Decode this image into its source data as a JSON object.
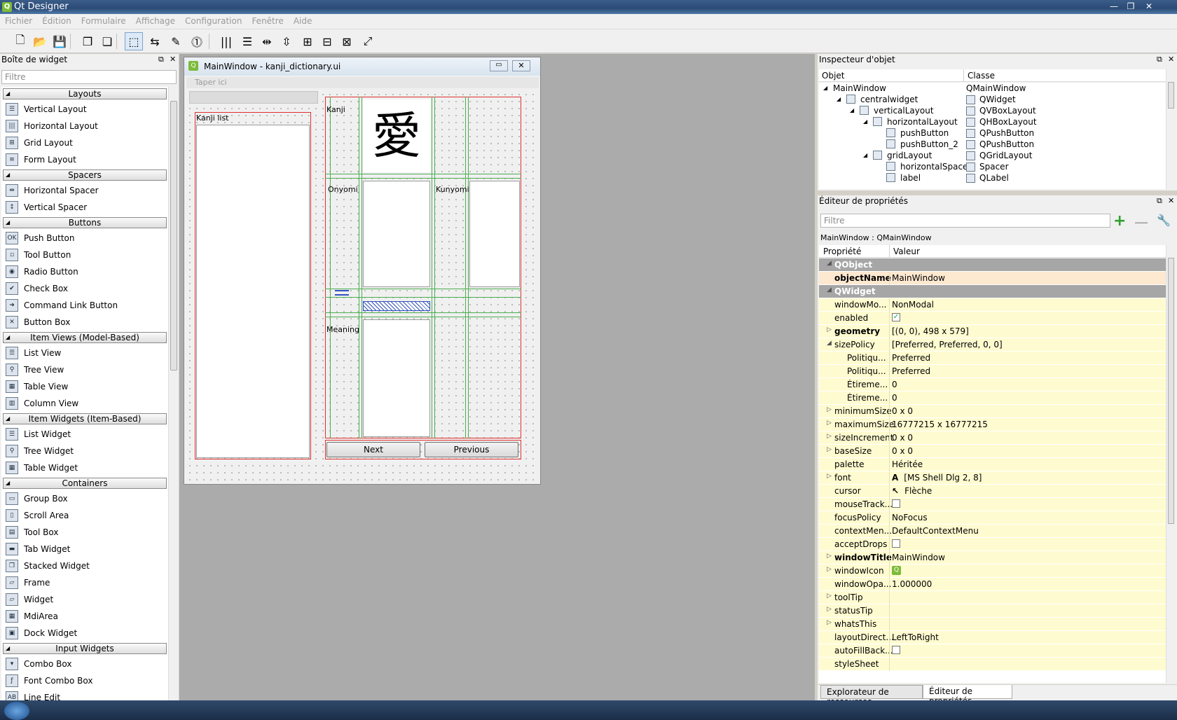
{
  "app": {
    "title": "Qt Designer",
    "icon": "qt-designer-icon"
  },
  "menu": [
    "Fichier",
    "Édition",
    "Formulaire",
    "Affichage",
    "Configuration",
    "Fenêtre",
    "Aide"
  ],
  "toolbar": {
    "icons": [
      "new-file-icon",
      "open-file-icon",
      "save-icon",
      "copy-icon",
      "paste-icon",
      "edit-widgets-icon",
      "edit-signals-icon",
      "edit-buddies-icon",
      "edit-tab-order-icon",
      "horizontal-layout-icon",
      "vertical-layout-icon",
      "horizontal-splitter-icon",
      "vertical-splitter-icon",
      "grid-layout-icon",
      "form-layout-icon",
      "break-layout-icon",
      "adjust-size-icon"
    ]
  },
  "widget_box": {
    "title": "Boîte de widget",
    "filter_placeholder": "Filtre",
    "categories": [
      {
        "name": "Layouts",
        "items": [
          {
            "label": "Vertical Layout",
            "icon": "vertical-layout-icon",
            "glyph": "☰"
          },
          {
            "label": "Horizontal Layout",
            "icon": "horizontal-layout-icon",
            "glyph": "|||"
          },
          {
            "label": "Grid Layout",
            "icon": "grid-layout-icon",
            "glyph": "⊞"
          },
          {
            "label": "Form Layout",
            "icon": "form-layout-icon",
            "glyph": "≡"
          }
        ]
      },
      {
        "name": "Spacers",
        "items": [
          {
            "label": "Horizontal Spacer",
            "icon": "horizontal-spacer-icon",
            "glyph": "⇹"
          },
          {
            "label": "Vertical Spacer",
            "icon": "vertical-spacer-icon",
            "glyph": "↕"
          }
        ]
      },
      {
        "name": "Buttons",
        "items": [
          {
            "label": "Push Button",
            "icon": "push-button-icon",
            "glyph": "OK"
          },
          {
            "label": "Tool Button",
            "icon": "tool-button-icon",
            "glyph": "▫"
          },
          {
            "label": "Radio Button",
            "icon": "radio-button-icon",
            "glyph": "◉"
          },
          {
            "label": "Check Box",
            "icon": "check-box-icon",
            "glyph": "✔"
          },
          {
            "label": "Command Link Button",
            "icon": "command-link-icon",
            "glyph": "➜"
          },
          {
            "label": "Button Box",
            "icon": "button-box-icon",
            "glyph": "✕"
          }
        ]
      },
      {
        "name": "Item Views (Model-Based)",
        "items": [
          {
            "label": "List View",
            "icon": "list-view-icon",
            "glyph": "☰"
          },
          {
            "label": "Tree View",
            "icon": "tree-view-icon",
            "glyph": "⚲"
          },
          {
            "label": "Table View",
            "icon": "table-view-icon",
            "glyph": "▦"
          },
          {
            "label": "Column View",
            "icon": "column-view-icon",
            "glyph": "▥"
          }
        ]
      },
      {
        "name": "Item Widgets (Item-Based)",
        "items": [
          {
            "label": "List Widget",
            "icon": "list-widget-icon",
            "glyph": "☰"
          },
          {
            "label": "Tree Widget",
            "icon": "tree-widget-icon",
            "glyph": "⚲"
          },
          {
            "label": "Table Widget",
            "icon": "table-widget-icon",
            "glyph": "▦"
          }
        ]
      },
      {
        "name": "Containers",
        "items": [
          {
            "label": "Group Box",
            "icon": "group-box-icon",
            "glyph": "▭"
          },
          {
            "label": "Scroll Area",
            "icon": "scroll-area-icon",
            "glyph": "▯"
          },
          {
            "label": "Tool Box",
            "icon": "tool-box-icon",
            "glyph": "▤"
          },
          {
            "label": "Tab Widget",
            "icon": "tab-widget-icon",
            "glyph": "▬"
          },
          {
            "label": "Stacked Widget",
            "icon": "stacked-widget-icon",
            "glyph": "❐"
          },
          {
            "label": "Frame",
            "icon": "frame-icon",
            "glyph": "▱"
          },
          {
            "label": "Widget",
            "icon": "widget-icon",
            "glyph": "▱"
          },
          {
            "label": "MdiArea",
            "icon": "mdi-area-icon",
            "glyph": "▦"
          },
          {
            "label": "Dock Widget",
            "icon": "dock-widget-icon",
            "glyph": "▣"
          }
        ]
      },
      {
        "name": "Input Widgets",
        "items": [
          {
            "label": "Combo Box",
            "icon": "combo-box-icon",
            "glyph": "▾"
          },
          {
            "label": "Font Combo Box",
            "icon": "font-combo-box-icon",
            "glyph": "ƒ"
          },
          {
            "label": "Line Edit",
            "icon": "line-edit-icon",
            "glyph": "AB"
          }
        ]
      }
    ]
  },
  "design_window": {
    "title": "MainWindow - kanji_dictionary.ui",
    "menu_placeholder": "Taper ici",
    "kanji_list_label": "Kanji list",
    "kanji_label": "Kanji",
    "kanji_char": "愛",
    "onyomi_label": "Onyomi",
    "kunyomi_label": "Kunyomi",
    "meaning_label": "Meaning",
    "next_button": "Next",
    "previous_button": "Previous"
  },
  "object_inspector": {
    "title": "Inspecteur d'objet",
    "col_object": "Objet",
    "col_class": "Classe",
    "rows": [
      {
        "name": "MainWindow",
        "cls": "QMainWindow",
        "icon": "",
        "indent": 0,
        "expand": "◢"
      },
      {
        "name": "centralwidget",
        "cls": "QWidget",
        "icon": "widget-icon",
        "indent": 1,
        "expand": "◢"
      },
      {
        "name": "verticalLayout",
        "cls": "QVBoxLayout",
        "icon": "vertical-layout-icon",
        "indent": 2,
        "expand": "◢"
      },
      {
        "name": "horizontalLayout",
        "cls": "QHBoxLayout",
        "icon": "horizontal-layout-icon",
        "indent": 3,
        "expand": "◢"
      },
      {
        "name": "pushButton",
        "cls": "QPushButton",
        "icon": "push-button-icon",
        "indent": 4,
        "expand": ""
      },
      {
        "name": "pushButton_2",
        "cls": "QPushButton",
        "icon": "push-button-icon",
        "indent": 4,
        "expand": ""
      },
      {
        "name": "gridLayout",
        "cls": "QGridLayout",
        "icon": "grid-layout-icon",
        "indent": 3,
        "expand": "◢"
      },
      {
        "name": "horizontalSpacer",
        "cls": "Spacer",
        "icon": "spacer-icon",
        "indent": 4,
        "expand": ""
      },
      {
        "name": "label",
        "cls": "QLabel",
        "icon": "label-icon",
        "indent": 4,
        "expand": ""
      }
    ]
  },
  "property_editor": {
    "title": "Éditeur de propriétés",
    "filter_placeholder": "Filtre",
    "context": "MainWindow : QMainWindow",
    "col_property": "Propriété",
    "col_value": "Valeur",
    "rows": [
      {
        "n": "QObject",
        "v": "",
        "t": "group"
      },
      {
        "n": "objectName",
        "v": "MainWindow",
        "t": "orange",
        "bold": true
      },
      {
        "n": "QWidget",
        "v": "",
        "t": "group"
      },
      {
        "n": "windowMo...",
        "v": "NonModal",
        "t": "yellow"
      },
      {
        "n": "enabled",
        "v": "",
        "t": "yellow",
        "check": "✓"
      },
      {
        "n": "geometry",
        "v": "[(0, 0), 498 x 579]",
        "t": "yellow",
        "bold": true,
        "ex": "▷"
      },
      {
        "n": "sizePolicy",
        "v": "[Preferred, Preferred, 0, 0]",
        "t": "yellow",
        "ex": "◢"
      },
      {
        "n": "Politiqu...",
        "v": "Preferred",
        "t": "yellow",
        "sub": true
      },
      {
        "n": "Politiqu...",
        "v": "Preferred",
        "t": "yellow",
        "sub": true
      },
      {
        "n": "Étireme...",
        "v": "0",
        "t": "yellow",
        "sub": true
      },
      {
        "n": "Étireme...",
        "v": "0",
        "t": "yellow",
        "sub": true
      },
      {
        "n": "minimumSize",
        "v": "0 x 0",
        "t": "yellow",
        "ex": "▷"
      },
      {
        "n": "maximumSize",
        "v": "16777215 x 16777215",
        "t": "yellow",
        "ex": "▷"
      },
      {
        "n": "sizeIncrement",
        "v": "0 x 0",
        "t": "yellow",
        "ex": "▷"
      },
      {
        "n": "baseSize",
        "v": "0 x 0",
        "t": "yellow",
        "ex": "▷"
      },
      {
        "n": "palette",
        "v": "Héritée",
        "t": "yellow"
      },
      {
        "n": "font",
        "v": "[MS Shell Dlg 2, 8]",
        "t": "yellow",
        "ex": "▷",
        "pre": "A"
      },
      {
        "n": "cursor",
        "v": "Flèche",
        "t": "yellow",
        "pre": "↖"
      },
      {
        "n": "mouseTrack...",
        "v": "",
        "t": "yellow",
        "check": " "
      },
      {
        "n": "focusPolicy",
        "v": "NoFocus",
        "t": "yellow"
      },
      {
        "n": "contextMen...",
        "v": "DefaultContextMenu",
        "t": "yellow"
      },
      {
        "n": "acceptDrops",
        "v": "",
        "t": "yellow",
        "check": " "
      },
      {
        "n": "windowTitle",
        "v": "MainWindow",
        "t": "yellow",
        "bold": true,
        "ex": "▷"
      },
      {
        "n": "windowIcon",
        "v": "",
        "t": "yellow",
        "ex": "▷",
        "pre": "Q"
      },
      {
        "n": "windowOpa...",
        "v": "1.000000",
        "t": "yellow"
      },
      {
        "n": "toolTip",
        "v": "",
        "t": "yellow",
        "ex": "▷"
      },
      {
        "n": "statusTip",
        "v": "",
        "t": "yellow",
        "ex": "▷"
      },
      {
        "n": "whatsThis",
        "v": "",
        "t": "yellow",
        "ex": "▷"
      },
      {
        "n": "layoutDirect...",
        "v": "LeftToRight",
        "t": "yellow"
      },
      {
        "n": "autoFillBack...",
        "v": "",
        "t": "yellow",
        "check": " "
      },
      {
        "n": "styleSheet",
        "v": "",
        "t": "yellow"
      }
    ]
  },
  "bottom_tabs": [
    "Explorateur de ressources",
    "Éditeur de propriétés"
  ]
}
